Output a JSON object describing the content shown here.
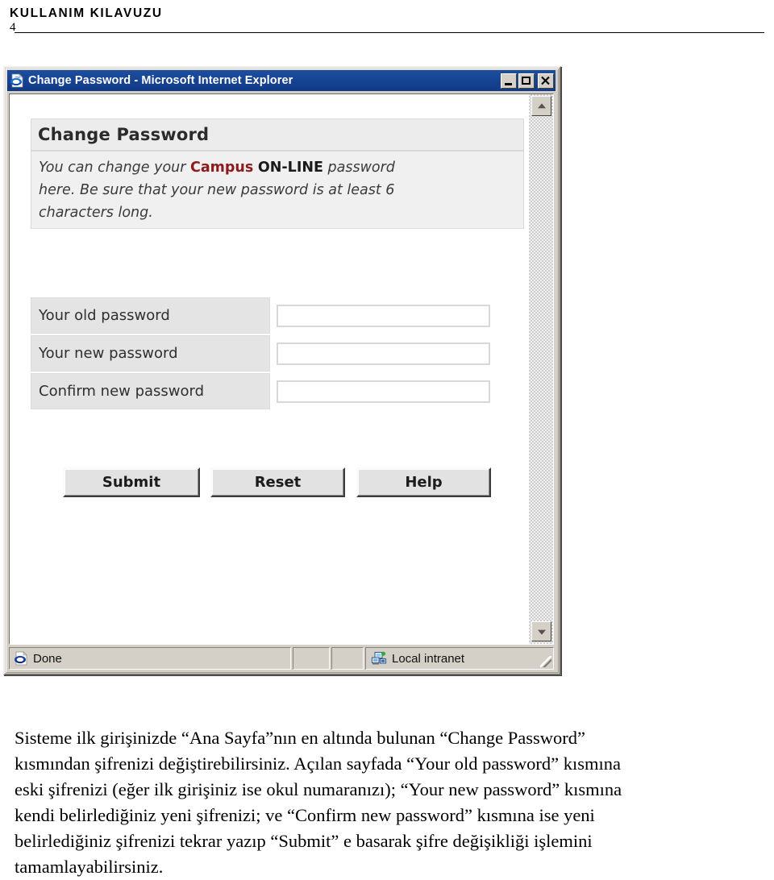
{
  "document": {
    "header_title": "KULLANIM KILAVUZU",
    "page_number": "4",
    "paragraph_lines": [
      "Sisteme ilk girişinizde “Ana Sayfa”nın en altında bulunan “Change Password”",
      "kısmından şifrenizi değiştirebilirsiniz. Açılan sayfada “Your old password” kısmına",
      "eski şifrenizi (eğer ilk girişiniz ise okul numaranızı); “Your new password” kısmına",
      "kendi belirlediğiniz yeni şifrenizi; ve “Confirm new password” kısmına ise yeni",
      "belirlediğiniz şifrenizi tekrar yazıp “Submit” e basarak şifre değişikliği işlemini",
      "tamamlayabilirsiniz."
    ]
  },
  "window": {
    "title": "Change Password - Microsoft Internet Explorer",
    "icon": "internet-explorer-icon",
    "controls": {
      "minimize": "minimize-icon",
      "maximize": "maximize-icon",
      "close": "close-icon"
    }
  },
  "scrollbar": {
    "up_arrow": "chevron-up-icon",
    "down_arrow": "chevron-down-icon"
  },
  "webpage": {
    "heading": "Change Password",
    "intro_lines": [
      {
        "before": "You can change your ",
        "campus": "Campus",
        "middle": " ",
        "online": "ON-LINE",
        "after": " password"
      },
      {
        "before": "here. Be sure that your new password is at least 6",
        "campus": "",
        "middle": "",
        "online": "",
        "after": ""
      },
      {
        "before": "characters long.",
        "campus": "",
        "middle": "",
        "online": "",
        "after": ""
      }
    ],
    "colors": {
      "campus_accent": "#8d1b1b",
      "online_accent": "#1a1a1a",
      "panel_background": "#ececec",
      "label_cell": "#e4e4e4"
    },
    "form_rows": [
      {
        "label": "Your old password",
        "value": "",
        "placeholder": ""
      },
      {
        "label": "Your new password",
        "value": "",
        "placeholder": ""
      },
      {
        "label": "Confirm new password",
        "value": "",
        "placeholder": ""
      }
    ],
    "buttons": {
      "submit": "Submit",
      "reset": "Reset",
      "help": "Help"
    }
  },
  "statusbar": {
    "status_text": "Done",
    "status_icon": "internet-explorer-icon",
    "zone_text": "Local intranet",
    "zone_icon": "local-intranet-icon"
  }
}
